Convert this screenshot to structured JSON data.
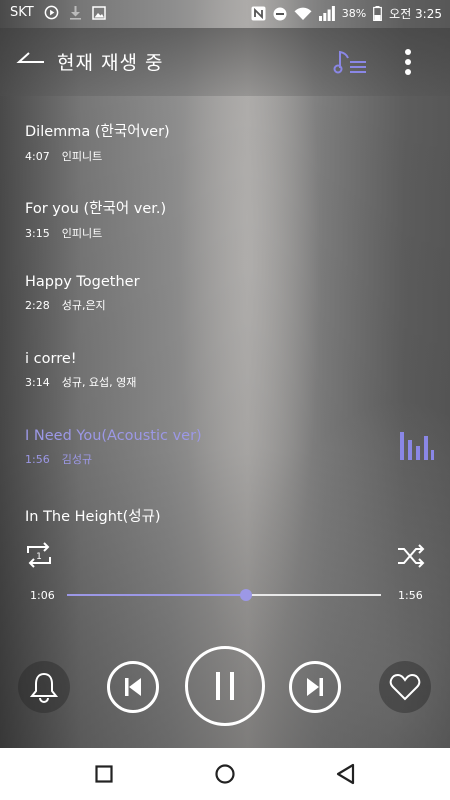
{
  "status_bar": {
    "carrier": "SKT",
    "battery_percent": "38%",
    "time": "오전 3:25",
    "left_icons": [
      "play-circle-icon",
      "download-icon",
      "image-icon"
    ],
    "right_icons": [
      "nfc-icon",
      "do-not-disturb-icon",
      "wifi-icon",
      "signal-icon",
      "battery-icon"
    ]
  },
  "header": {
    "title": "현재 재생 중",
    "icons": [
      "back-arrow-icon",
      "playlist-icon",
      "more-vert-icon"
    ]
  },
  "songs": [
    {
      "title": "Dilemma (한국어ver)",
      "duration": "4:07",
      "artist": "인피니트"
    },
    {
      "title": "For you (한국어 ver.)",
      "duration": "3:15",
      "artist": "인피니트"
    },
    {
      "title": "Happy Together",
      "duration": "2:28",
      "artist": "성규,은지"
    },
    {
      "title": "i corre!",
      "duration": "3:14",
      "artist": "성규, 요섭, 영재"
    },
    {
      "title": "I Need You(Acoustic ver)",
      "duration": "1:56",
      "artist": "김성규",
      "playing": true
    },
    {
      "title": "In The Height(성규)",
      "duration": "",
      "artist": ""
    }
  ],
  "player": {
    "elapsed": "1:06",
    "total": "1:56",
    "progress_fraction": 0.569,
    "repeat_mode_label": "1",
    "icons": [
      "repeat-one-icon",
      "shuffle-icon",
      "alarm-bell-icon",
      "skip-previous-icon",
      "pause-icon",
      "skip-next-icon",
      "heart-icon",
      "equalizer-icon"
    ]
  },
  "colors": {
    "accent": "#9c98e6",
    "text": "#ffffff",
    "navbar_bg": "#ffffff",
    "nav_icon": "#222222"
  },
  "nav_bar": {
    "icons": [
      "recent-apps-icon",
      "home-icon",
      "back-icon"
    ]
  }
}
